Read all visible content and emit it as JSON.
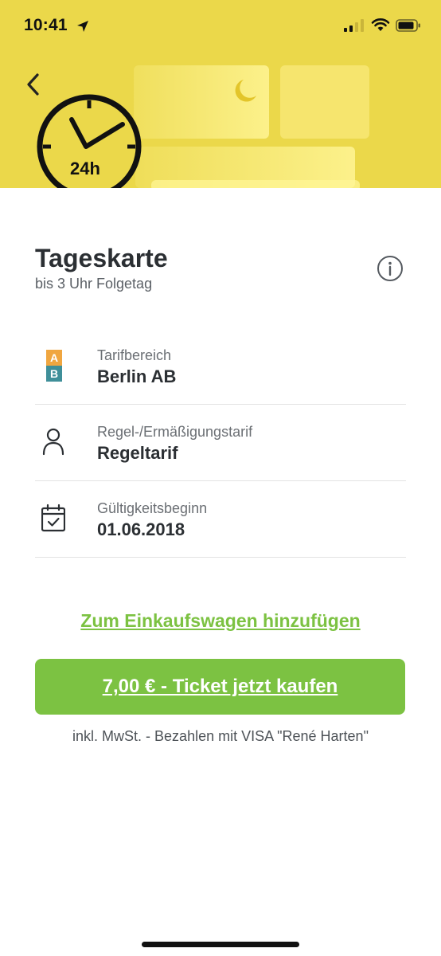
{
  "status_bar": {
    "time": "10:41",
    "icons": [
      "location-arrow-icon",
      "cellular-signal-icon",
      "wifi-icon",
      "battery-icon"
    ]
  },
  "header": {
    "back_icon": "chevron-left-icon",
    "illustration_icon": "clock-24h-icon",
    "clock_label": "24h",
    "background_color": "#ebd84a"
  },
  "ticket": {
    "title": "Tageskarte",
    "subtitle": "bis 3 Uhr Folgetag",
    "info_icon": "info-icon"
  },
  "details": [
    {
      "icon": "zone-ab-icon",
      "zone_a": "A",
      "zone_b": "B",
      "label": "Tarifbereich",
      "value": "Berlin AB"
    },
    {
      "icon": "person-icon",
      "label": "Regel-/Ermäßigungstarif",
      "value": "Regeltarif"
    },
    {
      "icon": "calendar-check-icon",
      "label": "Gültigkeitsbeginn",
      "value": "01.06.2018"
    }
  ],
  "actions": {
    "cart_link": "Zum Einkaufswagen hinzufügen",
    "buy_button": "7,00 € - Ticket jetzt kaufen",
    "payment_note": "inkl. MwSt. - Bezahlen mit VISA \"René Harten\""
  },
  "colors": {
    "accent_green": "#7cc242",
    "zone_a": "#f0a640",
    "zone_b": "#3f8f99",
    "text_dark": "#2b2f33"
  }
}
